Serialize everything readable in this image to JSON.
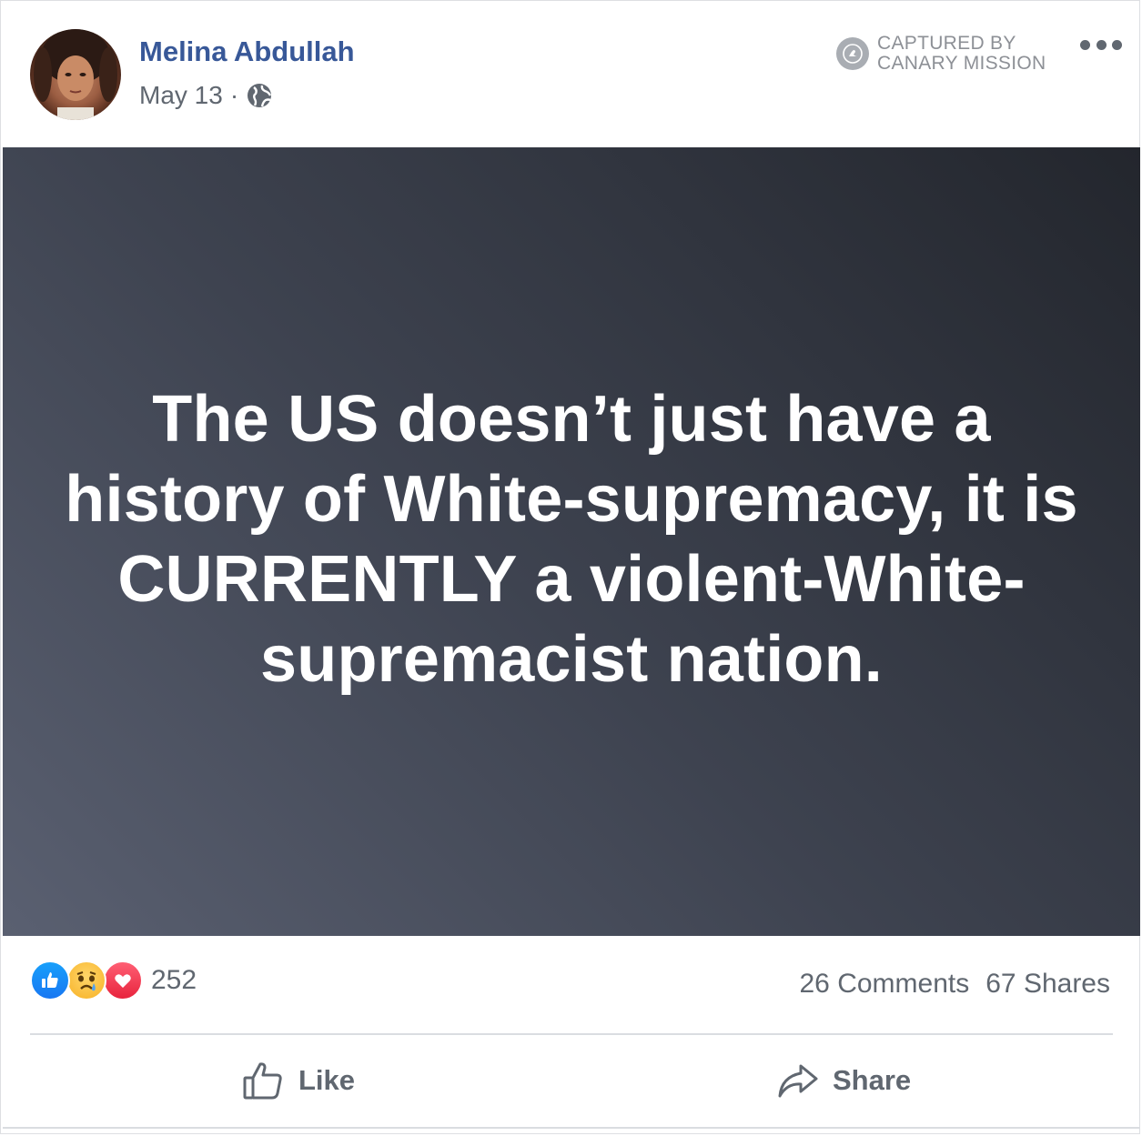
{
  "post": {
    "author": "Melina Abdullah",
    "date": "May 13",
    "separator": "·",
    "privacy_icon": "globe-icon",
    "watermark": {
      "line1": "CAPTURED BY",
      "line2": "CANARY MISSION",
      "icon": "canary-badge-icon"
    },
    "more_icon": "more-options-icon",
    "image_text": "The US doesn’t just have a history of White-supremacy, it is CURRENTLY a violent-White-supremacist nation.",
    "image_background": {
      "from": "#5a6071",
      "to": "#23262d"
    }
  },
  "stats": {
    "reaction_icons": [
      "like-reaction-icon",
      "sad-reaction-icon",
      "love-reaction-icon"
    ],
    "reaction_count": "252",
    "comments": "26 Comments",
    "shares": "67 Shares"
  },
  "actions": {
    "like_label": "Like",
    "share_label": "Share"
  },
  "colors": {
    "author_link": "#385898",
    "secondary_text": "#606770",
    "like_blue": "#1877f2",
    "love_red": "#e8243d"
  }
}
